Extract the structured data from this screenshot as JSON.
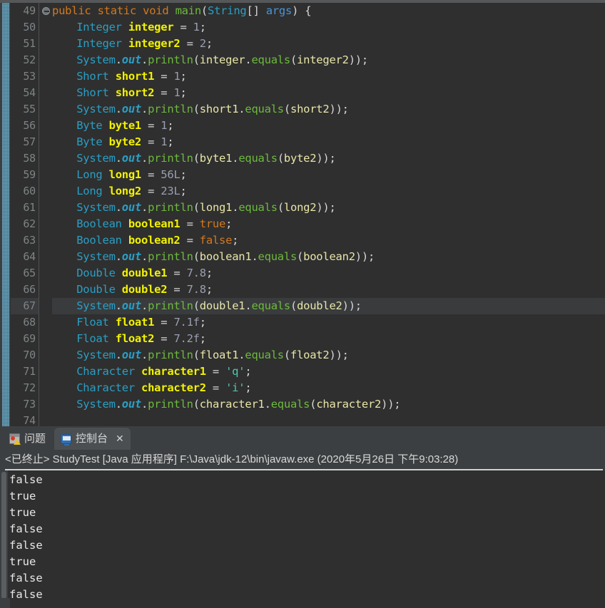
{
  "editor": {
    "first_line_number": 49,
    "highlighted_line": 67,
    "fold_marker_line": 49,
    "lines": [
      {
        "n": 49,
        "indent": 0,
        "tokens": [
          {
            "t": "public ",
            "c": "k"
          },
          {
            "t": "static ",
            "c": "k"
          },
          {
            "t": "void ",
            "c": "k"
          },
          {
            "t": "main",
            "c": "mth"
          },
          {
            "t": "(",
            "c": "pl"
          },
          {
            "t": "String",
            "c": "typ"
          },
          {
            "t": "[] ",
            "c": "pl"
          },
          {
            "t": "args",
            "c": "prm"
          },
          {
            "t": ") {",
            "c": "pl"
          }
        ]
      },
      {
        "n": 50,
        "indent": 1,
        "tokens": [
          {
            "t": "Integer ",
            "c": "typ"
          },
          {
            "t": "integer",
            "c": "var"
          },
          {
            "t": " = ",
            "c": "pl"
          },
          {
            "t": "1",
            "c": "num"
          },
          {
            "t": ";",
            "c": "pl"
          }
        ]
      },
      {
        "n": 51,
        "indent": 1,
        "tokens": [
          {
            "t": "Integer ",
            "c": "typ"
          },
          {
            "t": "integer2",
            "c": "var"
          },
          {
            "t": " = ",
            "c": "pl"
          },
          {
            "t": "2",
            "c": "num"
          },
          {
            "t": ";",
            "c": "pl"
          }
        ]
      },
      {
        "n": 52,
        "indent": 1,
        "tokens": [
          {
            "t": "System",
            "c": "typ"
          },
          {
            "t": ".",
            "c": "pl"
          },
          {
            "t": "out",
            "c": "fld"
          },
          {
            "t": ".",
            "c": "pl"
          },
          {
            "t": "println",
            "c": "mth"
          },
          {
            "t": "(",
            "c": "pl"
          },
          {
            "t": "integer",
            "c": "vr"
          },
          {
            "t": ".",
            "c": "pl"
          },
          {
            "t": "equals",
            "c": "mth"
          },
          {
            "t": "(",
            "c": "pl"
          },
          {
            "t": "integer2",
            "c": "vr"
          },
          {
            "t": "));",
            "c": "pl"
          }
        ]
      },
      {
        "n": 53,
        "indent": 1,
        "tokens": [
          {
            "t": "Short ",
            "c": "typ"
          },
          {
            "t": "short1",
            "c": "var"
          },
          {
            "t": " = ",
            "c": "pl"
          },
          {
            "t": "1",
            "c": "num"
          },
          {
            "t": ";",
            "c": "pl"
          }
        ]
      },
      {
        "n": 54,
        "indent": 1,
        "tokens": [
          {
            "t": "Short ",
            "c": "typ"
          },
          {
            "t": "short2",
            "c": "var"
          },
          {
            "t": " = ",
            "c": "pl"
          },
          {
            "t": "1",
            "c": "num"
          },
          {
            "t": ";",
            "c": "pl"
          }
        ]
      },
      {
        "n": 55,
        "indent": 1,
        "tokens": [
          {
            "t": "System",
            "c": "typ"
          },
          {
            "t": ".",
            "c": "pl"
          },
          {
            "t": "out",
            "c": "fld"
          },
          {
            "t": ".",
            "c": "pl"
          },
          {
            "t": "println",
            "c": "mth"
          },
          {
            "t": "(",
            "c": "pl"
          },
          {
            "t": "short1",
            "c": "vr"
          },
          {
            "t": ".",
            "c": "pl"
          },
          {
            "t": "equals",
            "c": "mth"
          },
          {
            "t": "(",
            "c": "pl"
          },
          {
            "t": "short2",
            "c": "vr"
          },
          {
            "t": "));",
            "c": "pl"
          }
        ]
      },
      {
        "n": 56,
        "indent": 1,
        "tokens": [
          {
            "t": "Byte ",
            "c": "typ"
          },
          {
            "t": "byte1",
            "c": "var"
          },
          {
            "t": " = ",
            "c": "pl"
          },
          {
            "t": "1",
            "c": "num"
          },
          {
            "t": ";",
            "c": "pl"
          }
        ]
      },
      {
        "n": 57,
        "indent": 1,
        "tokens": [
          {
            "t": "Byte ",
            "c": "typ"
          },
          {
            "t": "byte2",
            "c": "var"
          },
          {
            "t": " = ",
            "c": "pl"
          },
          {
            "t": "1",
            "c": "num"
          },
          {
            "t": ";",
            "c": "pl"
          }
        ]
      },
      {
        "n": 58,
        "indent": 1,
        "tokens": [
          {
            "t": "System",
            "c": "typ"
          },
          {
            "t": ".",
            "c": "pl"
          },
          {
            "t": "out",
            "c": "fld"
          },
          {
            "t": ".",
            "c": "pl"
          },
          {
            "t": "println",
            "c": "mth"
          },
          {
            "t": "(",
            "c": "pl"
          },
          {
            "t": "byte1",
            "c": "vr"
          },
          {
            "t": ".",
            "c": "pl"
          },
          {
            "t": "equals",
            "c": "mth"
          },
          {
            "t": "(",
            "c": "pl"
          },
          {
            "t": "byte2",
            "c": "vr"
          },
          {
            "t": "));",
            "c": "pl"
          }
        ]
      },
      {
        "n": 59,
        "indent": 1,
        "tokens": [
          {
            "t": "Long ",
            "c": "typ"
          },
          {
            "t": "long1",
            "c": "var"
          },
          {
            "t": " = ",
            "c": "pl"
          },
          {
            "t": "56L",
            "c": "num"
          },
          {
            "t": ";",
            "c": "pl"
          }
        ]
      },
      {
        "n": 60,
        "indent": 1,
        "tokens": [
          {
            "t": "Long ",
            "c": "typ"
          },
          {
            "t": "long2",
            "c": "var"
          },
          {
            "t": " = ",
            "c": "pl"
          },
          {
            "t": "23L",
            "c": "num"
          },
          {
            "t": ";",
            "c": "pl"
          }
        ]
      },
      {
        "n": 61,
        "indent": 1,
        "tokens": [
          {
            "t": "System",
            "c": "typ"
          },
          {
            "t": ".",
            "c": "pl"
          },
          {
            "t": "out",
            "c": "fld"
          },
          {
            "t": ".",
            "c": "pl"
          },
          {
            "t": "println",
            "c": "mth"
          },
          {
            "t": "(",
            "c": "pl"
          },
          {
            "t": "long1",
            "c": "vr"
          },
          {
            "t": ".",
            "c": "pl"
          },
          {
            "t": "equals",
            "c": "mth"
          },
          {
            "t": "(",
            "c": "pl"
          },
          {
            "t": "long2",
            "c": "vr"
          },
          {
            "t": "));",
            "c": "pl"
          }
        ]
      },
      {
        "n": 62,
        "indent": 1,
        "tokens": [
          {
            "t": "Boolean ",
            "c": "typ"
          },
          {
            "t": "boolean1",
            "c": "var"
          },
          {
            "t": " = ",
            "c": "pl"
          },
          {
            "t": "true",
            "c": "k"
          },
          {
            "t": ";",
            "c": "pl"
          }
        ]
      },
      {
        "n": 63,
        "indent": 1,
        "tokens": [
          {
            "t": "Boolean ",
            "c": "typ"
          },
          {
            "t": "boolean2",
            "c": "var"
          },
          {
            "t": " = ",
            "c": "pl"
          },
          {
            "t": "false",
            "c": "k"
          },
          {
            "t": ";",
            "c": "pl"
          }
        ]
      },
      {
        "n": 64,
        "indent": 1,
        "tokens": [
          {
            "t": "System",
            "c": "typ"
          },
          {
            "t": ".",
            "c": "pl"
          },
          {
            "t": "out",
            "c": "fld"
          },
          {
            "t": ".",
            "c": "pl"
          },
          {
            "t": "println",
            "c": "mth"
          },
          {
            "t": "(",
            "c": "pl"
          },
          {
            "t": "boolean1",
            "c": "vr"
          },
          {
            "t": ".",
            "c": "pl"
          },
          {
            "t": "equals",
            "c": "mth"
          },
          {
            "t": "(",
            "c": "pl"
          },
          {
            "t": "boolean2",
            "c": "vr"
          },
          {
            "t": "));",
            "c": "pl"
          }
        ]
      },
      {
        "n": 65,
        "indent": 1,
        "tokens": [
          {
            "t": "Double ",
            "c": "typ"
          },
          {
            "t": "double1",
            "c": "var"
          },
          {
            "t": " = ",
            "c": "pl"
          },
          {
            "t": "7.8",
            "c": "num"
          },
          {
            "t": ";",
            "c": "pl"
          }
        ]
      },
      {
        "n": 66,
        "indent": 1,
        "tokens": [
          {
            "t": "Double ",
            "c": "typ"
          },
          {
            "t": "double2",
            "c": "var"
          },
          {
            "t": " = ",
            "c": "pl"
          },
          {
            "t": "7.8",
            "c": "num"
          },
          {
            "t": ";",
            "c": "pl"
          }
        ]
      },
      {
        "n": 67,
        "indent": 1,
        "tokens": [
          {
            "t": "System",
            "c": "typ"
          },
          {
            "t": ".",
            "c": "pl"
          },
          {
            "t": "out",
            "c": "fld"
          },
          {
            "t": ".",
            "c": "pl"
          },
          {
            "t": "println",
            "c": "mth"
          },
          {
            "t": "(",
            "c": "pl"
          },
          {
            "t": "double1",
            "c": "vr"
          },
          {
            "t": ".",
            "c": "pl"
          },
          {
            "t": "equals",
            "c": "mth"
          },
          {
            "t": "(",
            "c": "pl"
          },
          {
            "t": "double2",
            "c": "vr"
          },
          {
            "t": "));",
            "c": "pl"
          }
        ]
      },
      {
        "n": 68,
        "indent": 1,
        "tokens": [
          {
            "t": "Float ",
            "c": "typ"
          },
          {
            "t": "float1",
            "c": "var"
          },
          {
            "t": " = ",
            "c": "pl"
          },
          {
            "t": "7.1f",
            "c": "num"
          },
          {
            "t": ";",
            "c": "pl"
          }
        ]
      },
      {
        "n": 69,
        "indent": 1,
        "tokens": [
          {
            "t": "Float ",
            "c": "typ"
          },
          {
            "t": "float2",
            "c": "var"
          },
          {
            "t": " = ",
            "c": "pl"
          },
          {
            "t": "7.2f",
            "c": "num"
          },
          {
            "t": ";",
            "c": "pl"
          }
        ]
      },
      {
        "n": 70,
        "indent": 1,
        "tokens": [
          {
            "t": "System",
            "c": "typ"
          },
          {
            "t": ".",
            "c": "pl"
          },
          {
            "t": "out",
            "c": "fld"
          },
          {
            "t": ".",
            "c": "pl"
          },
          {
            "t": "println",
            "c": "mth"
          },
          {
            "t": "(",
            "c": "pl"
          },
          {
            "t": "float1",
            "c": "vr"
          },
          {
            "t": ".",
            "c": "pl"
          },
          {
            "t": "equals",
            "c": "mth"
          },
          {
            "t": "(",
            "c": "pl"
          },
          {
            "t": "float2",
            "c": "vr"
          },
          {
            "t": "));",
            "c": "pl"
          }
        ]
      },
      {
        "n": 71,
        "indent": 1,
        "tokens": [
          {
            "t": "Character ",
            "c": "typ"
          },
          {
            "t": "character1",
            "c": "var"
          },
          {
            "t": " = ",
            "c": "pl"
          },
          {
            "t": "'q'",
            "c": "chr"
          },
          {
            "t": ";",
            "c": "pl"
          }
        ]
      },
      {
        "n": 72,
        "indent": 1,
        "tokens": [
          {
            "t": "Character ",
            "c": "typ"
          },
          {
            "t": "character2",
            "c": "var"
          },
          {
            "t": " = ",
            "c": "pl"
          },
          {
            "t": "'i'",
            "c": "chr"
          },
          {
            "t": ";",
            "c": "pl"
          }
        ]
      },
      {
        "n": 73,
        "indent": 1,
        "tokens": [
          {
            "t": "System",
            "c": "typ"
          },
          {
            "t": ".",
            "c": "pl"
          },
          {
            "t": "out",
            "c": "fld"
          },
          {
            "t": ".",
            "c": "pl"
          },
          {
            "t": "println",
            "c": "mth"
          },
          {
            "t": "(",
            "c": "pl"
          },
          {
            "t": "character1",
            "c": "vr"
          },
          {
            "t": ".",
            "c": "pl"
          },
          {
            "t": "equals",
            "c": "mth"
          },
          {
            "t": "(",
            "c": "pl"
          },
          {
            "t": "character2",
            "c": "vr"
          },
          {
            "t": "));",
            "c": "pl"
          }
        ]
      },
      {
        "n": 74,
        "indent": 1,
        "tokens": []
      }
    ]
  },
  "bottom": {
    "tabs": [
      {
        "label": "问题",
        "icon": "problems-icon",
        "active": false,
        "closable": false
      },
      {
        "label": "控制台",
        "icon": "console-icon",
        "active": true,
        "closable": true,
        "close_label": "✕"
      }
    ],
    "status_line": "<已终止> StudyTest [Java 应用程序] F:\\Java\\jdk-12\\bin\\javaw.exe  (2020年5月26日 下午9:03:28)",
    "console_output": [
      "false",
      "true",
      "true",
      "false",
      "false",
      "true",
      "false",
      "false"
    ]
  },
  "colors": {
    "editor_bg": "#2f2f2f",
    "panel_bg": "#3c3f41",
    "active_tab_bg": "#4b4f51",
    "line_number": "#7e8385",
    "current_line_hl": "#393b3d",
    "keyword": "#d2791e",
    "type": "#2a9ec4",
    "var_decl": "#f2f200",
    "var_ref": "#e8e6a8",
    "method": "#6cba3d",
    "number": "#9a9fb0",
    "char_literal": "#4ec9b0",
    "parameter": "#4a95d6",
    "console_text": "#e8e8e8",
    "annotation_marker": "#2d6e8c"
  }
}
